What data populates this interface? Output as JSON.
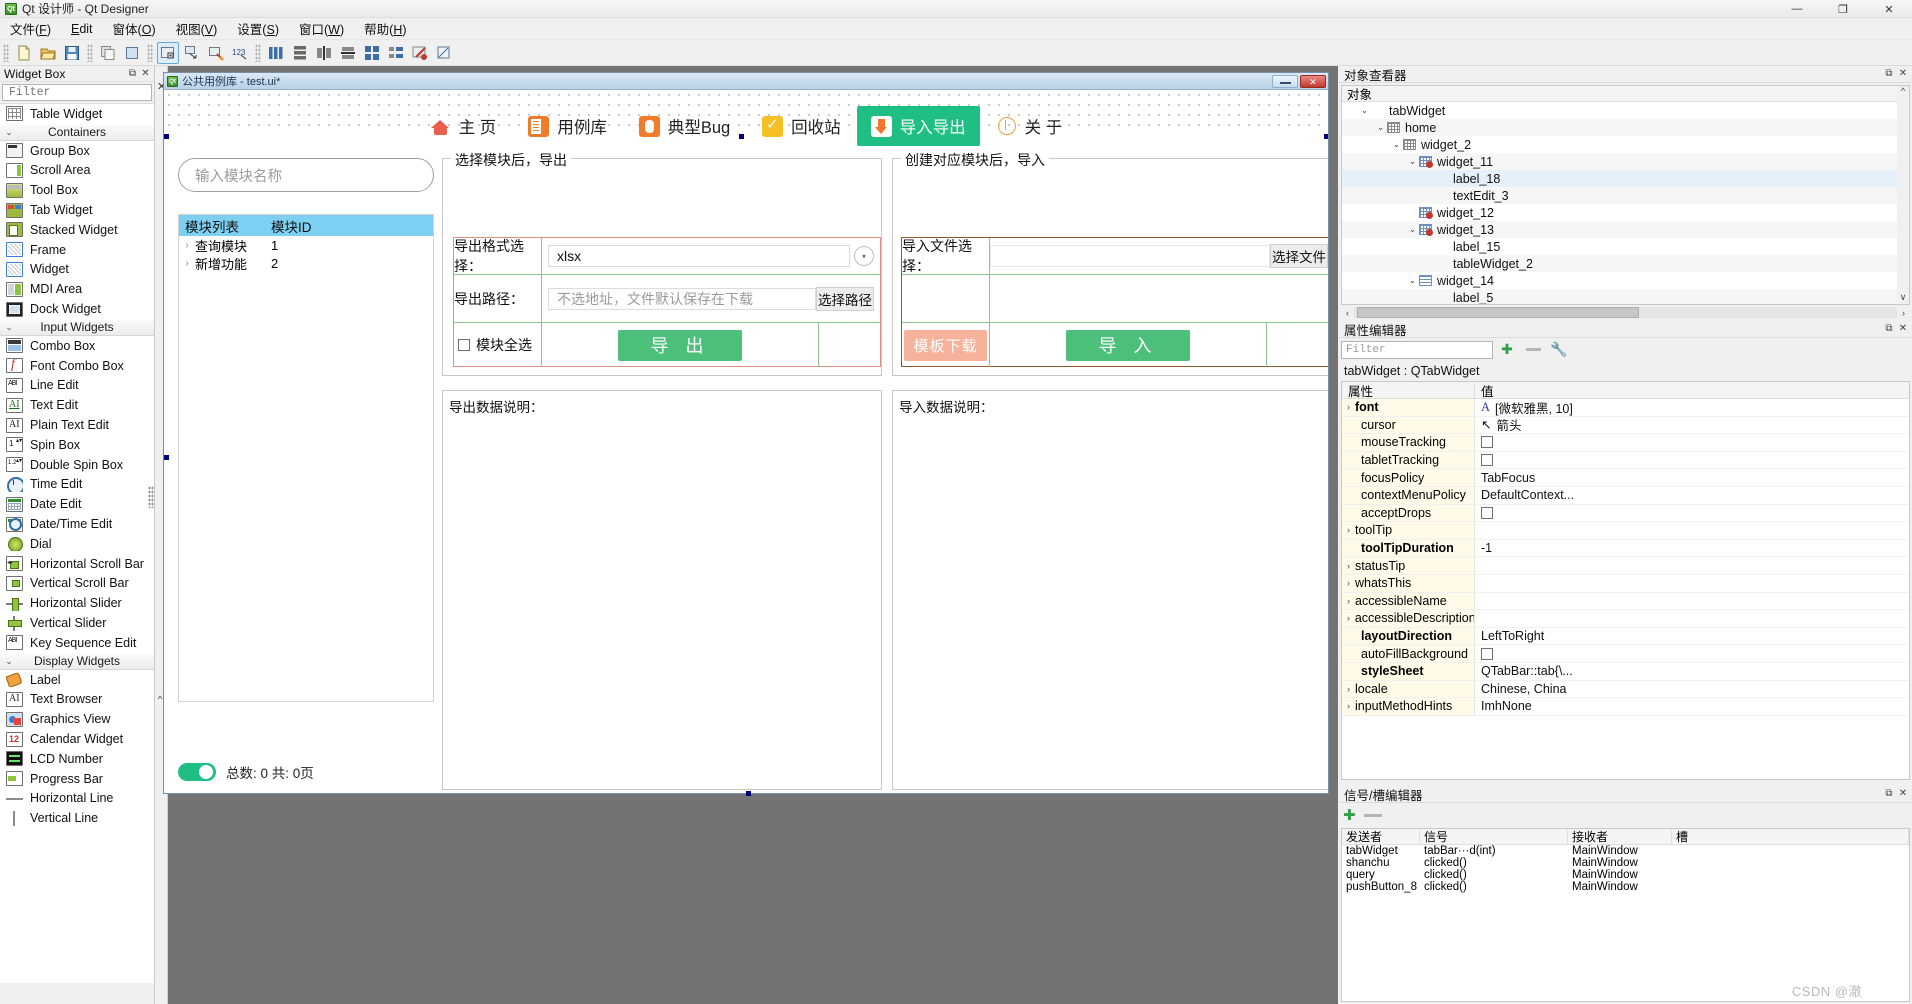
{
  "window": {
    "title": "Qt 设计师 - Qt Designer",
    "app_icon": "qt-logo-icon",
    "buttons": {
      "minimize": "—",
      "maximize": "❐",
      "close": "✕"
    }
  },
  "menubar": {
    "items": [
      {
        "label": "文件(F)",
        "name": "menu-file"
      },
      {
        "label": "Edit",
        "name": "menu-edit"
      },
      {
        "label": "窗体(O)",
        "name": "menu-form"
      },
      {
        "label": "视图(V)",
        "name": "menu-view"
      },
      {
        "label": "设置(S)",
        "name": "menu-settings"
      },
      {
        "label": "窗口(W)",
        "name": "menu-window"
      },
      {
        "label": "帮助(H)",
        "name": "menu-help"
      }
    ]
  },
  "toolbar": {
    "groups": [
      [
        "new-file-icon",
        "open-folder-icon",
        "save-icon"
      ],
      [
        "copy-icon",
        "paste-icon"
      ],
      [
        "edit-widgets-icon",
        "edit-signals-icon",
        "edit-buddies-icon",
        "edit-tab-order-icon"
      ],
      [
        "layout-horizontal-icon",
        "layout-vertical-icon",
        "layout-splitter-h-icon",
        "layout-splitter-v-icon",
        "layout-grid-icon",
        "layout-form-icon",
        "break-layout-icon",
        "adjust-size-icon"
      ]
    ]
  },
  "widget_box": {
    "title": "Widget Box",
    "undock_icon": "undock-icon",
    "close_icon": "close-icon",
    "filter_placeholder": "Filter",
    "items": [
      {
        "type": "item",
        "label": "Table Widget",
        "icon": "table-widget-icon",
        "icon_class": "ic-table"
      },
      {
        "type": "group",
        "label": "Containers",
        "icon": "chevron-down-icon"
      },
      {
        "type": "item",
        "label": "Group Box",
        "icon": "group-box-icon",
        "icon_class": "ic-groupbox"
      },
      {
        "type": "item",
        "label": "Scroll Area",
        "icon": "scroll-area-icon",
        "icon_class": "ic-scroll"
      },
      {
        "type": "item",
        "label": "Tool Box",
        "icon": "tool-box-icon",
        "icon_class": "ic-toolbox"
      },
      {
        "type": "item",
        "label": "Tab Widget",
        "icon": "tab-widget-icon",
        "icon_class": "ic-tabw"
      },
      {
        "type": "item",
        "label": "Stacked Widget",
        "icon": "stacked-widget-icon",
        "icon_class": "ic-stack"
      },
      {
        "type": "item",
        "label": "Frame",
        "icon": "frame-icon",
        "icon_class": "ic-frame"
      },
      {
        "type": "item",
        "label": "Widget",
        "icon": "widget-icon",
        "icon_class": "ic-frame"
      },
      {
        "type": "item",
        "label": "MDI Area",
        "icon": "mdi-area-icon",
        "icon_class": "ic-mdi"
      },
      {
        "type": "item",
        "label": "Dock Widget",
        "icon": "dock-widget-icon",
        "icon_class": "ic-dock"
      },
      {
        "type": "group",
        "label": "Input Widgets",
        "icon": "chevron-down-icon"
      },
      {
        "type": "item",
        "label": "Combo Box",
        "icon": "combo-box-icon",
        "icon_class": "ic-combo"
      },
      {
        "type": "item",
        "label": "Font Combo Box",
        "icon": "font-combo-box-icon",
        "icon_class": "ic-fontcombo"
      },
      {
        "type": "item",
        "label": "Line Edit",
        "icon": "line-edit-icon",
        "icon_class": "ic-line"
      },
      {
        "type": "item",
        "label": "Text Edit",
        "icon": "text-edit-icon",
        "icon_class": "ic-textedit"
      },
      {
        "type": "item",
        "label": "Plain Text Edit",
        "icon": "plain-text-edit-icon",
        "icon_class": "ic-plain"
      },
      {
        "type": "item",
        "label": "Spin Box",
        "icon": "spin-box-icon",
        "icon_class": "ic-spin"
      },
      {
        "type": "item",
        "label": "Double Spin Box",
        "icon": "double-spin-box-icon",
        "icon_class": "ic-dspin"
      },
      {
        "type": "item",
        "label": "Time Edit",
        "icon": "time-edit-icon",
        "icon_class": "ic-round"
      },
      {
        "type": "item",
        "label": "Date Edit",
        "icon": "date-edit-icon",
        "icon_class": "ic-cal"
      },
      {
        "type": "item",
        "label": "Date/Time Edit",
        "icon": "date-time-edit-icon",
        "icon_class": "ic-datetime"
      },
      {
        "type": "item",
        "label": "Dial",
        "icon": "dial-icon",
        "icon_class": "ic-dial"
      },
      {
        "type": "item",
        "label": "Horizontal Scroll Bar",
        "icon": "horizontal-scroll-bar-icon",
        "icon_class": "ic-hsb"
      },
      {
        "type": "item",
        "label": "Vertical Scroll Bar",
        "icon": "vertical-scroll-bar-icon",
        "icon_class": "ic-vsb"
      },
      {
        "type": "item",
        "label": "Horizontal Slider",
        "icon": "horizontal-slider-icon",
        "icon_class": "ic-hsl"
      },
      {
        "type": "item",
        "label": "Vertical Slider",
        "icon": "vertical-slider-icon",
        "icon_class": "ic-vsl"
      },
      {
        "type": "item",
        "label": "Key Sequence Edit",
        "icon": "key-sequence-edit-icon",
        "icon_class": "ic-keyseq"
      },
      {
        "type": "group",
        "label": "Display Widgets",
        "icon": "chevron-down-icon"
      },
      {
        "type": "item",
        "label": "Label",
        "icon": "label-icon",
        "icon_class": "ic-label"
      },
      {
        "type": "item",
        "label": "Text Browser",
        "icon": "text-browser-icon",
        "icon_class": "ic-browser"
      },
      {
        "type": "item",
        "label": "Graphics View",
        "icon": "graphics-view-icon",
        "icon_class": "ic-gview"
      },
      {
        "type": "item",
        "label": "Calendar Widget",
        "icon": "calendar-widget-icon",
        "icon_class": "ic-calw"
      },
      {
        "type": "item",
        "label": "LCD Number",
        "icon": "lcd-number-icon",
        "icon_class": "ic-lcd"
      },
      {
        "type": "item",
        "label": "Progress Bar",
        "icon": "progress-bar-icon",
        "icon_class": "ic-prog"
      },
      {
        "type": "item",
        "label": "Horizontal Line",
        "icon": "horizontal-line-icon",
        "icon_class": "ic-hline"
      },
      {
        "type": "item",
        "label": "Vertical Line",
        "icon": "vertical-line-icon",
        "icon_class": "ic-vline"
      }
    ]
  },
  "form_window": {
    "title": "公共用例库 - test.ui*",
    "icon": "qt-form-icon",
    "minimize_label": "minimize-icon",
    "close_label": "✕",
    "nav_tabs": [
      {
        "label": "主 页",
        "icon": "home-icon",
        "icon_class": "ni-home",
        "selected": false
      },
      {
        "label": "用例库",
        "icon": "usecase-doc-icon",
        "icon_class": "ni-doc",
        "selected": false
      },
      {
        "label": "典型Bug",
        "icon": "bug-icon",
        "icon_class": "ni-bug",
        "selected": false
      },
      {
        "label": "回收站",
        "icon": "recycle-bin-icon",
        "icon_class": "ni-recycle",
        "selected": false
      },
      {
        "label": "导入导出",
        "icon": "import-export-icon",
        "icon_class": "ni-io",
        "selected": true
      },
      {
        "label": "关 于",
        "icon": "about-icon",
        "icon_class": "ni-about",
        "selected": false
      }
    ],
    "left_panel": {
      "search_placeholder": "输入模块名称",
      "table": {
        "columns": [
          "模块列表",
          "模块ID"
        ],
        "header_bg": "#7ed0f2",
        "rows": [
          {
            "expander": "›",
            "name": "查询模块",
            "id": "1"
          },
          {
            "expander": "›",
            "name": "新增功能",
            "id": "2"
          }
        ]
      },
      "footer": {
        "toggle_on": true,
        "status": "总数: 0  共: 0页"
      }
    },
    "export_panel": {
      "group_title": "选择模块后，导出",
      "format_label": "导出格式选择：",
      "format_value": "xlsx",
      "format_dropdown_icon": "chevron-down-circle-icon",
      "path_label": "导出路径：",
      "path_placeholder": "不选地址，文件默认保存在下载",
      "path_button": "选择路径",
      "select_all_label": "模块全选",
      "select_all_checked": false,
      "export_button": "导 出",
      "export_button_color": "#4cbf7a",
      "desc_label": "导出数据说明："
    },
    "import_panel": {
      "group_title": "创建对应模块后，导入",
      "file_label": "导入文件选择：",
      "file_value": "",
      "file_button": "选择文件",
      "template_button": "模板下载",
      "template_button_color": "#f6b29b",
      "import_button": "导 入",
      "import_button_color": "#4cbf7a",
      "desc_label": "导入数据说明："
    }
  },
  "object_inspector": {
    "title": "对象查看器",
    "undock_icon": "undock-icon",
    "close_icon": "close-icon",
    "column_header": "对象",
    "rows": [
      {
        "label": "tabWidget",
        "indent": 1,
        "chev": "⌄",
        "icon": "",
        "selected": false
      },
      {
        "label": "home",
        "indent": 2,
        "chev": "⌄",
        "icon": "grid",
        "selected": false
      },
      {
        "label": "widget_2",
        "indent": 3,
        "chev": "⌄",
        "icon": "grid",
        "selected": false
      },
      {
        "label": "widget_11",
        "indent": 4,
        "chev": "⌄",
        "icon": "gridx",
        "selected": false
      },
      {
        "label": "label_18",
        "indent": 5,
        "chev": "",
        "icon": "",
        "selected": true
      },
      {
        "label": "textEdit_3",
        "indent": 5,
        "chev": "",
        "icon": "",
        "selected": false
      },
      {
        "label": "widget_12",
        "indent": 4,
        "chev": "",
        "icon": "gridx",
        "selected": false
      },
      {
        "label": "widget_13",
        "indent": 4,
        "chev": "⌄",
        "icon": "gridx",
        "selected": false
      },
      {
        "label": "label_15",
        "indent": 5,
        "chev": "",
        "icon": "",
        "selected": false
      },
      {
        "label": "tableWidget_2",
        "indent": 5,
        "chev": "",
        "icon": "",
        "selected": false
      },
      {
        "label": "widget_14",
        "indent": 4,
        "chev": "⌄",
        "icon": "rows",
        "selected": false
      },
      {
        "label": "label_5",
        "indent": 5,
        "chev": "",
        "icon": "",
        "selected": false
      }
    ]
  },
  "property_editor": {
    "title": "属性编辑器",
    "undock_icon": "undock-icon",
    "close_icon": "close-icon",
    "filter_placeholder": "Filter",
    "add_icon": "plus-icon",
    "remove_icon": "minus-icon",
    "config_icon": "wrench-icon",
    "object_line": "tabWidget : QTabWidget",
    "columns": [
      "属性",
      "值"
    ],
    "rows": [
      {
        "name": "font",
        "value": "[微软雅黑, 10]",
        "kind": "font",
        "expand": true,
        "bold": true
      },
      {
        "name": "cursor",
        "value": "箭头",
        "kind": "cursor",
        "expand": false,
        "bold": false
      },
      {
        "name": "mouseTracking",
        "value": "",
        "kind": "checkbox",
        "expand": false,
        "bold": false
      },
      {
        "name": "tabletTracking",
        "value": "",
        "kind": "checkbox",
        "expand": false,
        "bold": false
      },
      {
        "name": "focusPolicy",
        "value": "TabFocus",
        "kind": "text",
        "expand": false,
        "bold": false
      },
      {
        "name": "contextMenuPolicy",
        "value": "DefaultContext...",
        "kind": "text",
        "expand": false,
        "bold": false
      },
      {
        "name": "acceptDrops",
        "value": "",
        "kind": "checkbox",
        "expand": false,
        "bold": false
      },
      {
        "name": "toolTip",
        "value": "",
        "kind": "text",
        "expand": true,
        "bold": false
      },
      {
        "name": "toolTipDuration",
        "value": "-1",
        "kind": "text",
        "expand": false,
        "bold": true
      },
      {
        "name": "statusTip",
        "value": "",
        "kind": "text",
        "expand": true,
        "bold": false
      },
      {
        "name": "whatsThis",
        "value": "",
        "kind": "text",
        "expand": true,
        "bold": false
      },
      {
        "name": "accessibleName",
        "value": "",
        "kind": "text",
        "expand": true,
        "bold": false
      },
      {
        "name": "accessibleDescription",
        "value": "",
        "kind": "text",
        "expand": true,
        "bold": false
      },
      {
        "name": "layoutDirection",
        "value": "LeftToRight",
        "kind": "text",
        "expand": false,
        "bold": true
      },
      {
        "name": "autoFillBackground",
        "value": "",
        "kind": "checkbox",
        "expand": false,
        "bold": false
      },
      {
        "name": "styleSheet",
        "value": "QTabBar::tab{\\...",
        "kind": "text",
        "expand": false,
        "bold": true
      },
      {
        "name": "locale",
        "value": "Chinese, China",
        "kind": "text",
        "expand": true,
        "bold": false
      },
      {
        "name": "inputMethodHints",
        "value": "ImhNone",
        "kind": "text",
        "expand": true,
        "bold": false
      }
    ]
  },
  "signal_slot_editor": {
    "title": "信号/槽编辑器",
    "undock_icon": "undock-icon",
    "close_icon": "close-icon",
    "add_icon": "plus-icon",
    "remove_icon": "minus-icon",
    "columns": [
      "发送者",
      "信号",
      "接收者",
      "槽"
    ],
    "rows": [
      {
        "sender": "tabWidget",
        "signal": "tabBar···d(int)",
        "receiver": "MainWindow",
        "slot": ""
      },
      {
        "sender": "shanchu",
        "signal": "clicked()",
        "receiver": "MainWindow",
        "slot": ""
      },
      {
        "sender": "query",
        "signal": "clicked()",
        "receiver": "MainWindow",
        "slot": ""
      },
      {
        "sender": "pushButton_8",
        "signal": "clicked()",
        "receiver": "MainWindow",
        "slot": ""
      }
    ]
  },
  "watermark": "CSDN @澈"
}
